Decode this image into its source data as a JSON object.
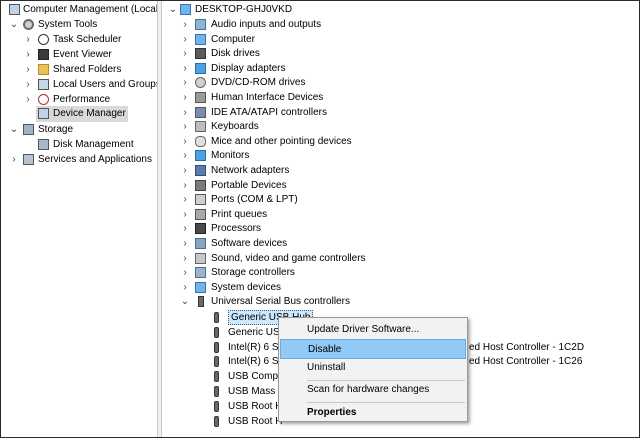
{
  "left_tree": {
    "items": [
      {
        "label": "Computer Management (Local",
        "icon": "computer-management-icon"
      },
      {
        "label": "System Tools",
        "icon": "system-tools-icon"
      },
      {
        "label": "Task Scheduler",
        "icon": "clock-icon"
      },
      {
        "label": "Event Viewer",
        "icon": "event-viewer-icon"
      },
      {
        "label": "Shared Folders",
        "icon": "shared-folder-icon"
      },
      {
        "label": "Local Users and Groups",
        "icon": "users-icon"
      },
      {
        "label": "Performance",
        "icon": "performance-icon"
      },
      {
        "label": "Device Manager",
        "icon": "device-manager-icon"
      },
      {
        "label": "Storage",
        "icon": "storage-icon"
      },
      {
        "label": "Disk Management",
        "icon": "disk-icon"
      },
      {
        "label": "Services and Applications",
        "icon": "services-icon"
      }
    ]
  },
  "device_tree": {
    "root": "DESKTOP-GHJ0VKD",
    "categories": [
      "Audio inputs and outputs",
      "Computer",
      "Disk drives",
      "Display adapters",
      "DVD/CD-ROM drives",
      "Human Interface Devices",
      "IDE ATA/ATAPI controllers",
      "Keyboards",
      "Mice and other pointing devices",
      "Monitors",
      "Network adapters",
      "Portable Devices",
      "Ports (COM & LPT)",
      "Print queues",
      "Processors",
      "Software devices",
      "Sound, video and game controllers",
      "Storage controllers",
      "System devices",
      "Universal Serial Bus controllers"
    ],
    "usb_children": [
      "Generic USB Hub",
      "Generic USB",
      "Intel(R) 6 Se",
      "Intel(R) 6 Se",
      "USB Compo",
      "USB Mass S",
      "USB Root H",
      "USB Root H"
    ],
    "usb_child_suffixes": [
      "",
      "",
      "ed Host Controller - 1C2D",
      "ed Host Controller - 1C26",
      "",
      "",
      "",
      ""
    ]
  },
  "context_menu": {
    "items": [
      {
        "label": "Update Driver Software..."
      },
      {
        "label": "Disable"
      },
      {
        "label": "Uninstall"
      },
      {
        "label": "Scan for hardware changes"
      },
      {
        "label": "Properties"
      }
    ]
  },
  "colors": {
    "menu_highlight": "#91c9f7",
    "selection": "#d9d9d9"
  }
}
